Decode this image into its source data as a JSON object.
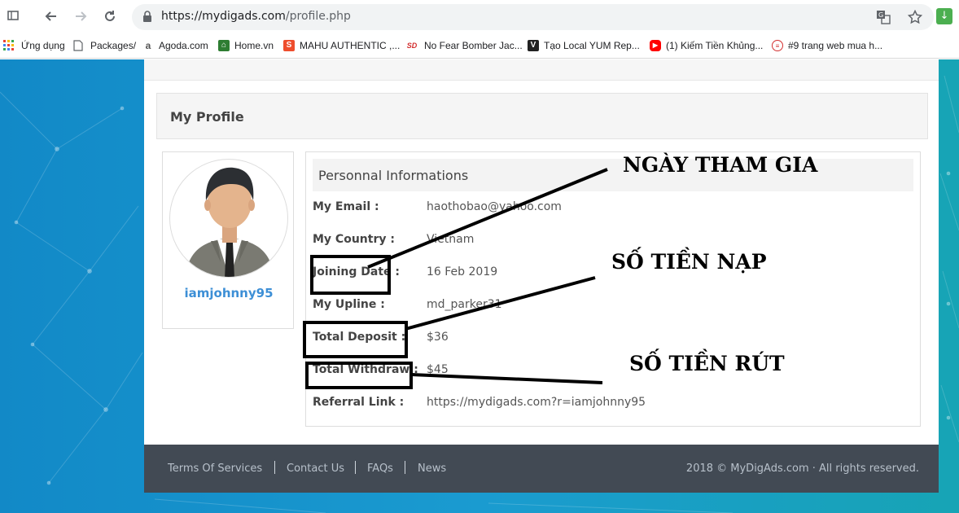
{
  "browser": {
    "url_host": "https://mydigads.com",
    "url_path": "/profile.php",
    "bookmarks": [
      {
        "label": "Ứng dụng",
        "icon": "apps-grid-icon",
        "color": "#ea4335"
      },
      {
        "label": "Packages/",
        "icon": "page-icon",
        "color": "#ffffff"
      },
      {
        "label": "Agoda.com",
        "icon": "agoda-icon",
        "color": "#ffffff"
      },
      {
        "label": "Home.vn",
        "icon": "home-vn-icon",
        "color": "#2e7d32"
      },
      {
        "label": "MAHU AUTHENTIC ,...",
        "icon": "shopee-icon",
        "color": "#ee4d2d"
      },
      {
        "label": "No Fear Bomber Jac...",
        "icon": "sd-icon",
        "color": "#ffffff"
      },
      {
        "label": "Tạo Local YUM Rep...",
        "icon": "v-icon",
        "color": "#222222"
      },
      {
        "label": "(1) Kiếm Tiền Khủng...",
        "icon": "youtube-icon",
        "color": "#ff0000"
      },
      {
        "label": "#9 trang web mua h...",
        "icon": "site-icon",
        "color": "#ffffff"
      }
    ]
  },
  "page": {
    "section_title": "My Profile",
    "username": "iamjohnny95",
    "info_title": "Personnal Informations",
    "fields": [
      {
        "label": "My Email :",
        "value": "haothobao@yahoo.com"
      },
      {
        "label": "My Country :",
        "value": "Vietnam"
      },
      {
        "label": "Joining Date :",
        "value": "16 Feb 2019"
      },
      {
        "label": "My Upline :",
        "value": "md_parker31"
      },
      {
        "label": "Total Deposit :",
        "value": "$36"
      },
      {
        "label": "Total Withdraw :",
        "value": "$45"
      },
      {
        "label": "Referral Link :",
        "value": "https://mydigads.com?r=iamjohnny95"
      }
    ]
  },
  "footer": {
    "links": [
      "Terms Of Services",
      "Contact Us",
      "FAQs",
      "News"
    ],
    "copyright": "2018 © MyDigAds.com · All rights reserved."
  },
  "annotations": {
    "joining": "NGÀY THAM GIA",
    "deposit": "SỐ TIỀN NẠP",
    "withdraw": "SỐ TIỀN RÚT"
  },
  "colors": {
    "accent_username": "#3d8fd6",
    "footer_bg": "#424a54",
    "page_bg": "#1a9bd0"
  }
}
